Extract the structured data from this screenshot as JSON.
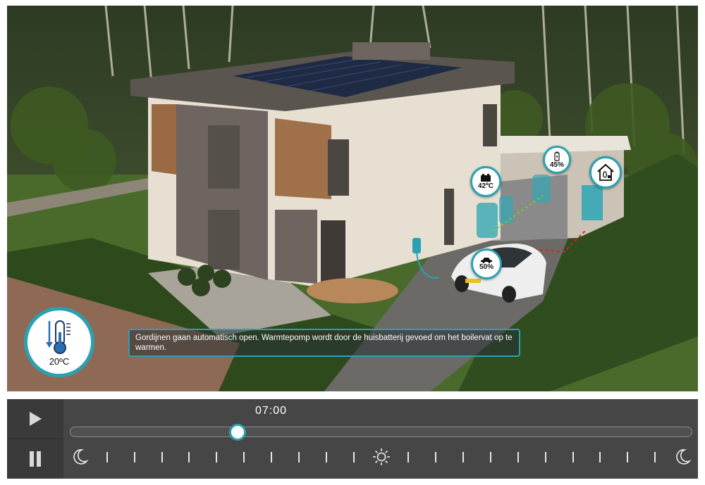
{
  "hotspots": {
    "boiler": {
      "label": "42ºC"
    },
    "house_battery": {
      "label": "45%"
    },
    "car_battery": {
      "label": "50%"
    }
  },
  "thermostat": {
    "label": "20ºC"
  },
  "message": "Gordijnen gaan automatisch open. Warmtepomp wordt door de huisbatterij gevoed om het boilervat op te warmen.",
  "controls": {
    "time": "07:00",
    "progress": 0.27,
    "timeline_ticks": [
      "moon-icon",
      "tick",
      "tick",
      "tick",
      "tick",
      "tick",
      "tick",
      "tick",
      "tick",
      "tick",
      "tick",
      "sun-icon",
      "tick",
      "tick",
      "tick",
      "tick",
      "tick",
      "tick",
      "tick",
      "tick",
      "tick",
      "tick",
      "moon-icon"
    ]
  },
  "colors": {
    "accent": "#2aa1b3",
    "control_bar": "#464646",
    "cable_green": "#7ed321",
    "cable_red": "#e02020"
  }
}
